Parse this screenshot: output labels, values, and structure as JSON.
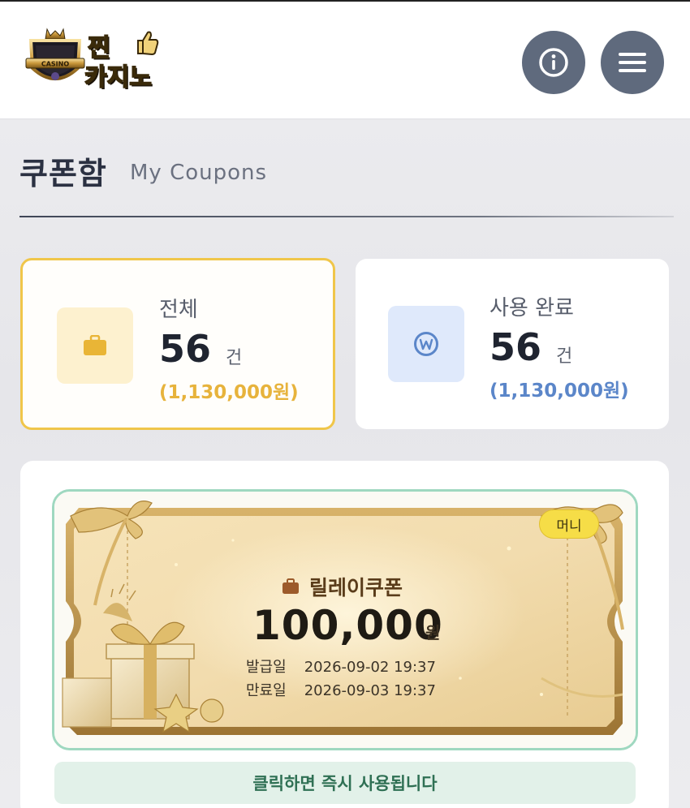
{
  "header": {
    "logo": {
      "line1": "찐",
      "line2": "카지노",
      "badge_text": "CASINO"
    },
    "info_button_icon": "info-icon",
    "menu_button_icon": "hamburger-menu-icon"
  },
  "page": {
    "title": "쿠폰함",
    "subtitle": "My Coupons"
  },
  "stats": {
    "all": {
      "label": "전체",
      "count": "56",
      "unit": "건",
      "amount": "(1,130,000원)",
      "icon": "bag-icon",
      "accent": "#f0c64a"
    },
    "used": {
      "label": "사용 완료",
      "count": "56",
      "unit": "건",
      "amount": "(1,130,000원)",
      "icon": "won-coin-icon",
      "accent": "#5b86c9"
    }
  },
  "coupon": {
    "badge": "머니",
    "name": "릴레이쿠폰",
    "amount": "100,000",
    "currency": "원",
    "issued_label": "발급일",
    "issued_value": "2026-09-02 19:37",
    "expire_label": "만료일",
    "expire_value": "2026-09-03 19:37",
    "action_text": "클릭하면 즉시 사용됩니다"
  }
}
